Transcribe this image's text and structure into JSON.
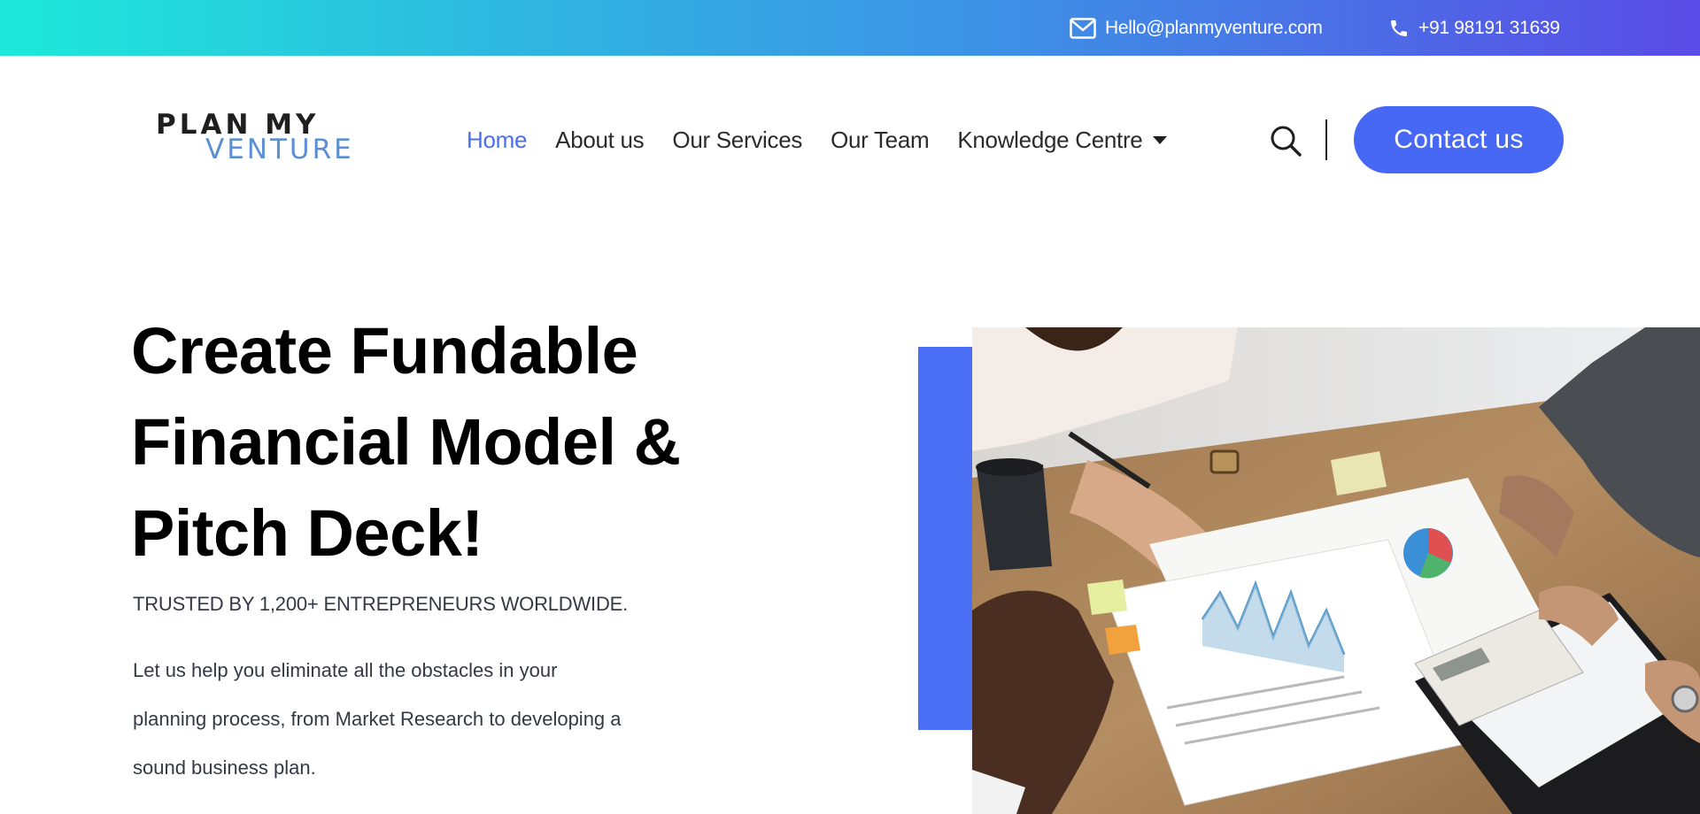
{
  "topbar": {
    "email": "Hello@planmyventure.com",
    "phone": "+91 98191 31639",
    "email_icon": "mail-icon",
    "phone_icon": "phone-icon"
  },
  "header": {
    "logo_line1": "PLAN MY",
    "logo_line2": "VENTURE",
    "nav": [
      {
        "label": "Home",
        "active": true
      },
      {
        "label": "About us"
      },
      {
        "label": "Our Services"
      },
      {
        "label": "Our Team"
      },
      {
        "label": "Knowledge Centre",
        "has_dropdown": true
      }
    ],
    "search_icon": "search-icon",
    "contact_label": "Contact us"
  },
  "hero": {
    "title_line1": "Create Fundable",
    "title_line2": "Financial Model &",
    "title_line3": "Pitch Deck!",
    "trust_text": "TRUSTED BY 1,200+ ENTREPRENEURS WORLDWIDE.",
    "description_line1": "Let us help you eliminate all the obstacles in your",
    "description_line2": "planning process, from Market Research to developing a",
    "description_line3": "sound business plan."
  },
  "colors": {
    "accent": "#4668f5",
    "nav_active": "#4a6ff0",
    "gradient_start": "#1de9d9",
    "gradient_end": "#5a4be6"
  }
}
